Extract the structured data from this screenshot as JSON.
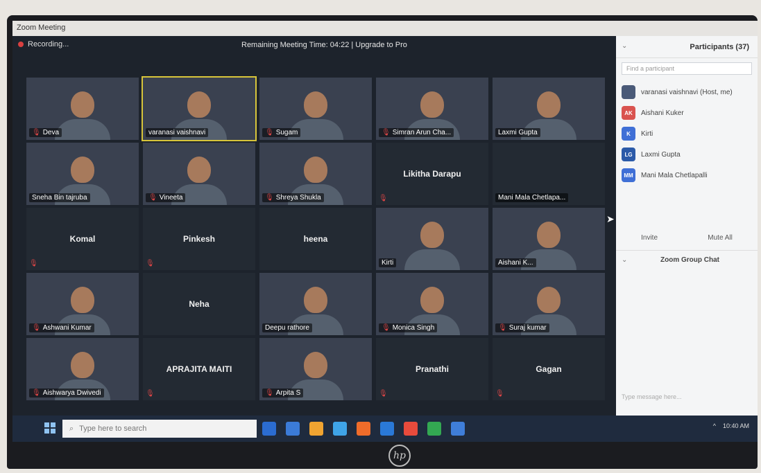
{
  "window": {
    "title": "Zoom Meeting"
  },
  "meeting": {
    "recording_label": "Recording...",
    "remaining": "Remaining Meeting Time: 04:22 | Upgrade to Pro"
  },
  "tiles": [
    {
      "name": "Deva",
      "type": "video",
      "muted": true
    },
    {
      "name": "varanasi vaishnavi",
      "type": "video",
      "muted": false,
      "active": true
    },
    {
      "name": "Sugam",
      "type": "video",
      "muted": true
    },
    {
      "name": "Simran Arun Cha...",
      "type": "video",
      "muted": true
    },
    {
      "name": "Laxmi Gupta",
      "type": "video",
      "muted": false
    },
    {
      "name": "Sneha Bin tajruba",
      "type": "video",
      "muted": false
    },
    {
      "name": "Vineeta",
      "type": "video",
      "muted": true
    },
    {
      "name": "Shreya Shukla",
      "type": "video",
      "muted": true
    },
    {
      "name": "Likitha Darapu",
      "type": "name",
      "muted": true
    },
    {
      "name": "Mani Mala Chetlapa...",
      "type": "name-label",
      "muted": false
    },
    {
      "name": "Komal",
      "type": "name",
      "muted": true
    },
    {
      "name": "Pinkesh",
      "type": "name",
      "muted": true
    },
    {
      "name": "heena",
      "type": "name",
      "muted": false
    },
    {
      "name": "Kirti",
      "type": "video",
      "muted": false
    },
    {
      "name": "Aishani K...",
      "type": "video",
      "muted": false
    },
    {
      "name": "Ashwani Kumar",
      "type": "video",
      "muted": true
    },
    {
      "name": "Neha",
      "type": "name",
      "muted": false
    },
    {
      "name": "Deepu rathore",
      "type": "video",
      "muted": false
    },
    {
      "name": "Monica Singh",
      "type": "video",
      "muted": true
    },
    {
      "name": "Suraj kumar",
      "type": "video",
      "muted": true
    },
    {
      "name": "Aishwarya Dwivedi",
      "type": "video",
      "muted": true
    },
    {
      "name": "APRAJITA MAITI",
      "type": "name",
      "muted": true
    },
    {
      "name": "Arpita S",
      "type": "video",
      "muted": true
    },
    {
      "name": "Pranathi",
      "type": "name",
      "muted": true
    },
    {
      "name": "Gagan",
      "type": "name",
      "muted": true
    }
  ],
  "participants": {
    "title": "Participants (37)",
    "find_placeholder": "Find a participant",
    "list": [
      {
        "initials": "",
        "name": "varanasi vaishnavi (Host, me)",
        "color": "#4a5a78"
      },
      {
        "initials": "AK",
        "name": "Aishani Kuker",
        "color": "#d9534f"
      },
      {
        "initials": "K",
        "name": "Kirti",
        "color": "#3f6fd6"
      },
      {
        "initials": "LG",
        "name": "Laxmi Gupta",
        "color": "#2b5aa8"
      },
      {
        "initials": "MM",
        "name": "Mani Mala Chetlapalli",
        "color": "#3f6fd6"
      }
    ],
    "invite_label": "Invite",
    "mute_all_label": "Mute All"
  },
  "chat": {
    "title": "Zoom Group Chat",
    "input_placeholder": "Type message here..."
  },
  "taskbar": {
    "search_placeholder": "Type here to search",
    "apps": [
      "#2b6cd1",
      "#3b7bd8",
      "#f0a431",
      "#3fa4e8",
      "#ef6c2a",
      "#2a79d8",
      "#e84b3c",
      "#33a852",
      "#3f7ed9"
    ],
    "clock": "10:40 AM"
  },
  "brand": {
    "logo": "hp"
  }
}
